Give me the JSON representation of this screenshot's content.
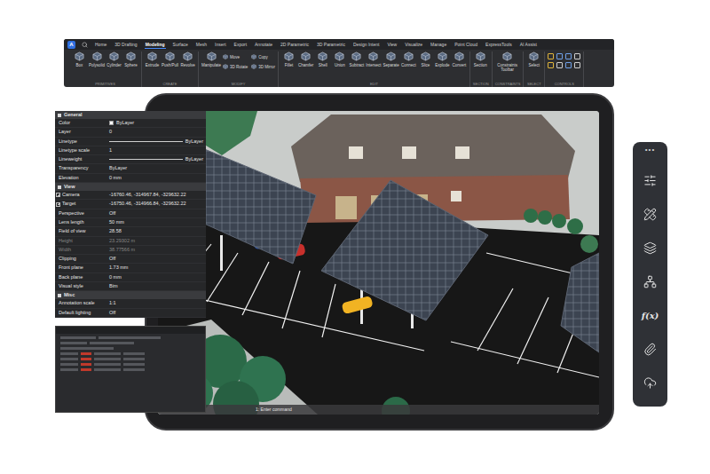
{
  "ribbon": {
    "logo": "A",
    "tabs": [
      {
        "label": "Home",
        "selected": false
      },
      {
        "label": "3D Drafting",
        "selected": false
      },
      {
        "label": "Modeling",
        "selected": true
      },
      {
        "label": "Surface",
        "selected": false
      },
      {
        "label": "Mesh",
        "selected": false
      },
      {
        "label": "Insert",
        "selected": false
      },
      {
        "label": "Export",
        "selected": false
      },
      {
        "label": "Annotate",
        "selected": false
      },
      {
        "label": "2D Parametric",
        "selected": false
      },
      {
        "label": "3D Parametric",
        "selected": false
      },
      {
        "label": "Design Intent",
        "selected": false
      },
      {
        "label": "View",
        "selected": false
      },
      {
        "label": "Visualize",
        "selected": false
      },
      {
        "label": "Manage",
        "selected": false
      },
      {
        "label": "Point Cloud",
        "selected": false
      },
      {
        "label": "ExpressTools",
        "selected": false
      },
      {
        "label": "AI Assist",
        "selected": false
      }
    ],
    "groups": [
      {
        "label": "PRIMITIVES",
        "kind": "tools",
        "tools": [
          {
            "label": "Box",
            "kind": "large"
          },
          {
            "label": "Polysolid",
            "kind": "large"
          },
          {
            "label": "Cylinder",
            "kind": "large"
          },
          {
            "label": "Sphere",
            "kind": "large"
          }
        ]
      },
      {
        "label": "CREATE",
        "kind": "tools",
        "tools": [
          {
            "label": "Extrude",
            "kind": "large"
          },
          {
            "label": "Push/Pull",
            "kind": "large"
          },
          {
            "label": "Revolve",
            "kind": "large"
          }
        ]
      },
      {
        "label": "MODIFY",
        "kind": "tools",
        "tools": [
          {
            "label": "Manipulate",
            "kind": "large"
          },
          {
            "label": "Move",
            "kind": "small"
          },
          {
            "label": "Copy",
            "kind": "small"
          },
          {
            "label": "3D Rotate",
            "kind": "small"
          },
          {
            "label": "3D Mirror",
            "kind": "small"
          }
        ]
      },
      {
        "label": "EDIT",
        "kind": "tools",
        "tools": [
          {
            "label": "Fillet",
            "kind": "large"
          },
          {
            "label": "Chamfer",
            "kind": "large"
          },
          {
            "label": "Shell",
            "kind": "large"
          },
          {
            "label": "Union",
            "kind": "large"
          },
          {
            "label": "Subtract",
            "kind": "large"
          },
          {
            "label": "Intersect",
            "kind": "large"
          },
          {
            "label": "Separate",
            "kind": "large"
          },
          {
            "label": "Connect",
            "kind": "large"
          },
          {
            "label": "Slice",
            "kind": "large"
          },
          {
            "label": "Explode",
            "kind": "large"
          },
          {
            "label": "Convert",
            "kind": "large"
          }
        ]
      },
      {
        "label": "SECTION",
        "kind": "tools",
        "tools": [
          {
            "label": "Section",
            "kind": "large"
          }
        ]
      },
      {
        "label": "CONSTRAINTS",
        "kind": "tools",
        "tools": [
          {
            "label": "Constraints Toolbar",
            "kind": "large"
          }
        ]
      },
      {
        "label": "SELECT",
        "kind": "tools",
        "tools": [
          {
            "label": "Select",
            "kind": "large"
          }
        ]
      },
      {
        "label": "CONTROLS",
        "kind": "icons",
        "tools": []
      }
    ]
  },
  "properties": {
    "sections": [
      {
        "title": "General",
        "expanded": true,
        "rows": [
          {
            "label": "Color",
            "value": "ByLayer",
            "kind": "swatch",
            "disabled": false,
            "expandable": false
          },
          {
            "label": "Layer",
            "value": "0",
            "kind": "text",
            "disabled": false,
            "expandable": false
          },
          {
            "label": "Linetype",
            "value": "ByLayer",
            "kind": "line",
            "disabled": false,
            "expandable": false
          },
          {
            "label": "Linetype scale",
            "value": "1",
            "kind": "text",
            "disabled": false,
            "expandable": false
          },
          {
            "label": "Lineweight",
            "value": "ByLayer",
            "kind": "line",
            "disabled": false,
            "expandable": false
          },
          {
            "label": "Transparency",
            "value": "ByLayer",
            "kind": "text",
            "disabled": false,
            "expandable": false
          },
          {
            "label": "Elevation",
            "value": "0 mm",
            "kind": "text",
            "disabled": false,
            "expandable": false
          }
        ]
      },
      {
        "title": "View",
        "expanded": true,
        "rows": [
          {
            "label": "Camera",
            "value": "-16760.46, -314967.84, -329632.22",
            "kind": "text",
            "disabled": false,
            "expandable": true
          },
          {
            "label": "Target",
            "value": "-16750.46, -314966.84, -329632.22",
            "kind": "text",
            "disabled": false,
            "expandable": true
          },
          {
            "label": "Perspective",
            "value": "Off",
            "kind": "text",
            "disabled": false,
            "expandable": false
          },
          {
            "label": "Lens length",
            "value": "50 mm",
            "kind": "text",
            "disabled": false,
            "expandable": false
          },
          {
            "label": "Field of view",
            "value": "28.58",
            "kind": "text",
            "disabled": false,
            "expandable": false
          },
          {
            "label": "Height",
            "value": "23.29302 m",
            "kind": "text",
            "disabled": true,
            "expandable": false
          },
          {
            "label": "Width",
            "value": "38.77566 m",
            "kind": "text",
            "disabled": true,
            "expandable": false
          },
          {
            "label": "Clipping",
            "value": "Off",
            "kind": "text",
            "disabled": false,
            "expandable": false
          },
          {
            "label": "Front plane",
            "value": "1.73 mm",
            "kind": "text",
            "disabled": false,
            "expandable": false
          },
          {
            "label": "Back plane",
            "value": "0 mm",
            "kind": "text",
            "disabled": false,
            "expandable": false
          },
          {
            "label": "Visual style",
            "value": "Bim",
            "kind": "text",
            "disabled": false,
            "expandable": false
          }
        ]
      },
      {
        "title": "Misc",
        "expanded": true,
        "rows": [
          {
            "label": "Annotation scale",
            "value": "1:1",
            "kind": "text",
            "disabled": false,
            "expandable": false
          },
          {
            "label": "Default lighting",
            "value": "Off",
            "kind": "text",
            "disabled": false,
            "expandable": false
          }
        ]
      }
    ]
  },
  "viewport": {
    "command_line": "1: Enter command"
  },
  "side_toolbar": {
    "menu": "•••",
    "formula": "f(x)"
  }
}
